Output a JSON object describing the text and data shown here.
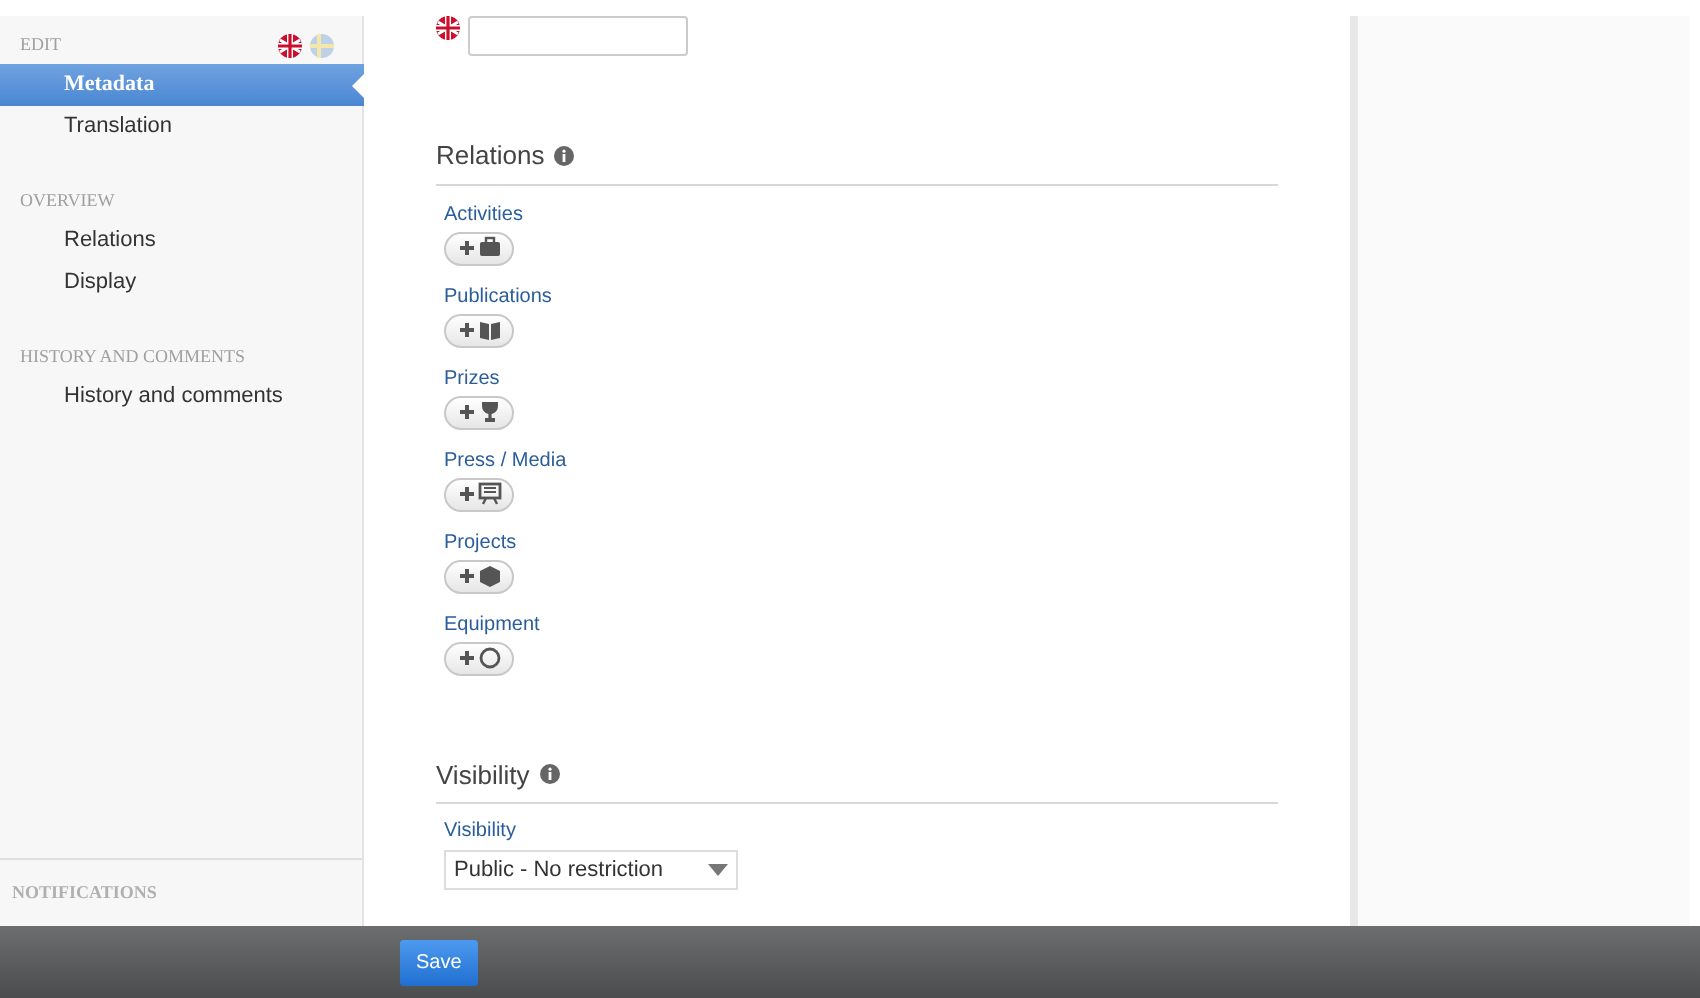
{
  "sidebar": {
    "languages": [
      {
        "kind": "uk",
        "selected": true
      },
      {
        "kind": "se",
        "selected": false
      }
    ],
    "sections": [
      {
        "heading": "EDIT",
        "items": [
          {
            "label": "Metadata",
            "selected": true
          },
          {
            "label": "Translation",
            "selected": false
          }
        ]
      },
      {
        "heading": "OVERVIEW",
        "items": [
          {
            "label": "Relations",
            "selected": false
          },
          {
            "label": "Display",
            "selected": false
          }
        ]
      },
      {
        "heading": "HISTORY AND COMMENTS",
        "items": [
          {
            "label": "History and comments",
            "selected": false
          }
        ]
      }
    ],
    "footer_heading": "NOTIFICATIONS"
  },
  "relations": {
    "heading": "Relations",
    "items": [
      {
        "label": "Activities",
        "kind": "briefcase"
      },
      {
        "label": "Publications",
        "kind": "book"
      },
      {
        "label": "Prizes",
        "kind": "trophy"
      },
      {
        "label": "Press / Media",
        "kind": "screen"
      },
      {
        "label": "Projects",
        "kind": "cube"
      },
      {
        "label": "Equipment",
        "kind": "circle"
      }
    ]
  },
  "visibility": {
    "heading": "Visibility",
    "label": "Visibility",
    "value": "Public - No restriction"
  },
  "buttons": [
    "Save"
  ]
}
